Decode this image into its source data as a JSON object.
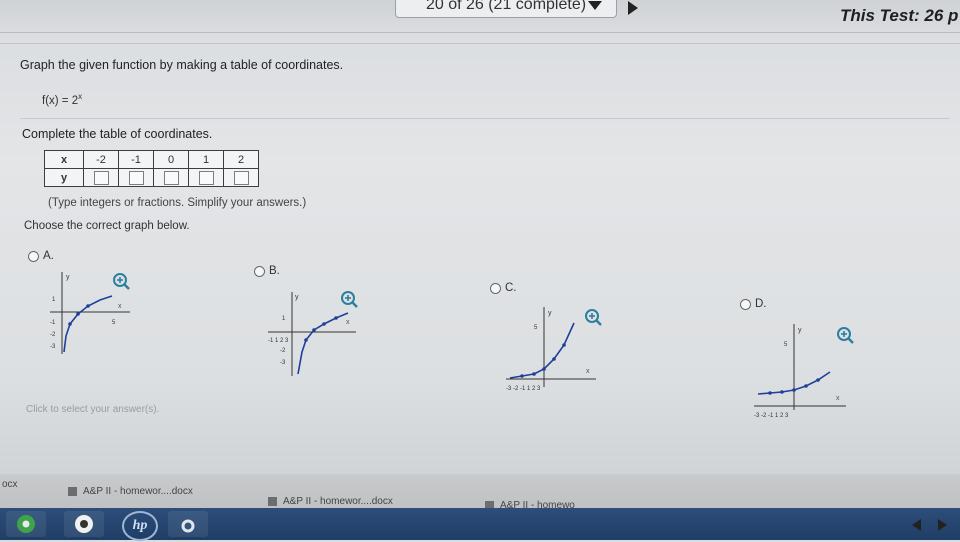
{
  "header": {
    "progress_text": "20 of 26 (21 complete)",
    "test_title": "This Test: 26 p"
  },
  "question": {
    "instruction": "Graph the given function by making a table of coordinates.",
    "function": "f(x) = 2",
    "exponent": "x",
    "complete_label": "Complete the table of coordinates.",
    "table": {
      "x_header": "x",
      "y_header": "y",
      "x_values": [
        "-2",
        "-1",
        "0",
        "1",
        "2"
      ]
    },
    "hint": "(Type integers or fractions. Simplify your answers.)",
    "choose_label": "Choose the correct graph below.",
    "options": [
      {
        "letter": "A."
      },
      {
        "letter": "B."
      },
      {
        "letter": "C."
      },
      {
        "letter": "D."
      }
    ],
    "click_hint": "Click to select your answer(s)."
  },
  "graph_labels": {
    "a": {
      "y": "y",
      "x": "x",
      "tick1": "1",
      "tick5": "5",
      "neg1": "-1",
      "neg2": "-2",
      "neg3": "-3"
    },
    "b": {
      "y": "y",
      "x": "x",
      "tick1": "1",
      "ticks": "-1  1  2  3",
      "neg1": "-1",
      "neg2": "-2",
      "neg3": "-3"
    },
    "c": {
      "y": "y",
      "x": "x",
      "tick5": "5",
      "ticks": "-3 -2 -1  1  2  3"
    },
    "d": {
      "y": "y",
      "x": "x",
      "tick5": "5",
      "ticks": "-3 -2 -1  1  2  3"
    }
  },
  "taskbar_files": [
    {
      "name": "A&P II - homewor....docx"
    },
    {
      "name": "A&P II - homewor....docx"
    },
    {
      "name": "A&P II - homewo"
    }
  ],
  "taskbar_left_file": "ocx",
  "os_taskbar": {
    "hp_logo": "hp"
  },
  "colors": {
    "accent": "#2b7f9e",
    "curve": "#1f3f9a"
  }
}
